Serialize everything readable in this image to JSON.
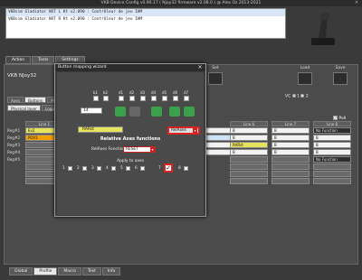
{
  "window": {
    "title": "VKB Device Config v0.90.17 ( Njoy32 firmware v2.08.0 ) @ Alex Oz 2013-2021",
    "close": "×"
  },
  "devices": [
    {
      "text": "VKBsim Gladiator NXT L  Kt v2.090       : Contrôleur de jeu IHM"
    },
    {
      "text": "VKBsim Gladiator NXT R  Kt v2.090       : Contrôleur de jeu IHM"
    }
  ],
  "top_tabs": [
    "Action",
    "Tools",
    "Settings"
  ],
  "device_name": "VKB NJoy32",
  "set_label": "Set",
  "load_label": "Load",
  "save_label": "Save",
  "vc": {
    "label": "VC",
    "opt1": "1",
    "opt2": "2"
  },
  "sub_tabs": [
    "Axes",
    "Buttons",
    "Pr"
  ],
  "sub_tabs2": [
    "Physical layer",
    "Logic"
  ],
  "poll_label": "Poll",
  "row_labels": [
    "Reg#1",
    "Reg#2",
    "Reg#3",
    "Reg#4",
    "Reg#5"
  ],
  "line_headers": [
    "Line 1",
    "Line 6",
    "Line 7",
    "Line 8"
  ],
  "grid_values": {
    "l1r1": "Ev2",
    "l1r2": "POV1",
    "l6r1": "B",
    "l6r2": "Sw",
    "l6r3": "B",
    "l6r4": "B",
    "l6b1": "B",
    "l6b2": "B",
    "l6b3": "RARst",
    "l6b4": "B",
    "l7r1": "B",
    "l7r2": "B",
    "l7r3": "B",
    "l7r4": "B",
    "l8r1": "No Function",
    "l8r2": "B",
    "l8r3": "B",
    "l8r4": "B",
    "l8r5": "No Function"
  },
  "bottom_tabs": [
    "Global",
    "Profile",
    "Macro",
    "Test",
    "Info"
  ],
  "dialog": {
    "title": "Button mapping wizard",
    "close": "×",
    "bits": [
      "b1",
      "b2",
      "d1",
      "d2",
      "d3",
      "d4",
      "d5",
      "d6",
      "d7"
    ],
    "number": "14",
    "rarst": "RARst",
    "rel_axes": "RelAxes",
    "rel_header": "Relative Axes functions",
    "rel_func_label": "RelAxes Function",
    "rel_func_value": "RESET",
    "apply_label": "Apply to axes",
    "axes": [
      "1",
      "2",
      "3",
      "4",
      "5",
      "6",
      "7",
      "8"
    ],
    "checked_axis": "✓"
  },
  "colors": {
    "accent_red": "#dd2222",
    "yellow": "#e8e35c",
    "orange": "#f0a000"
  }
}
